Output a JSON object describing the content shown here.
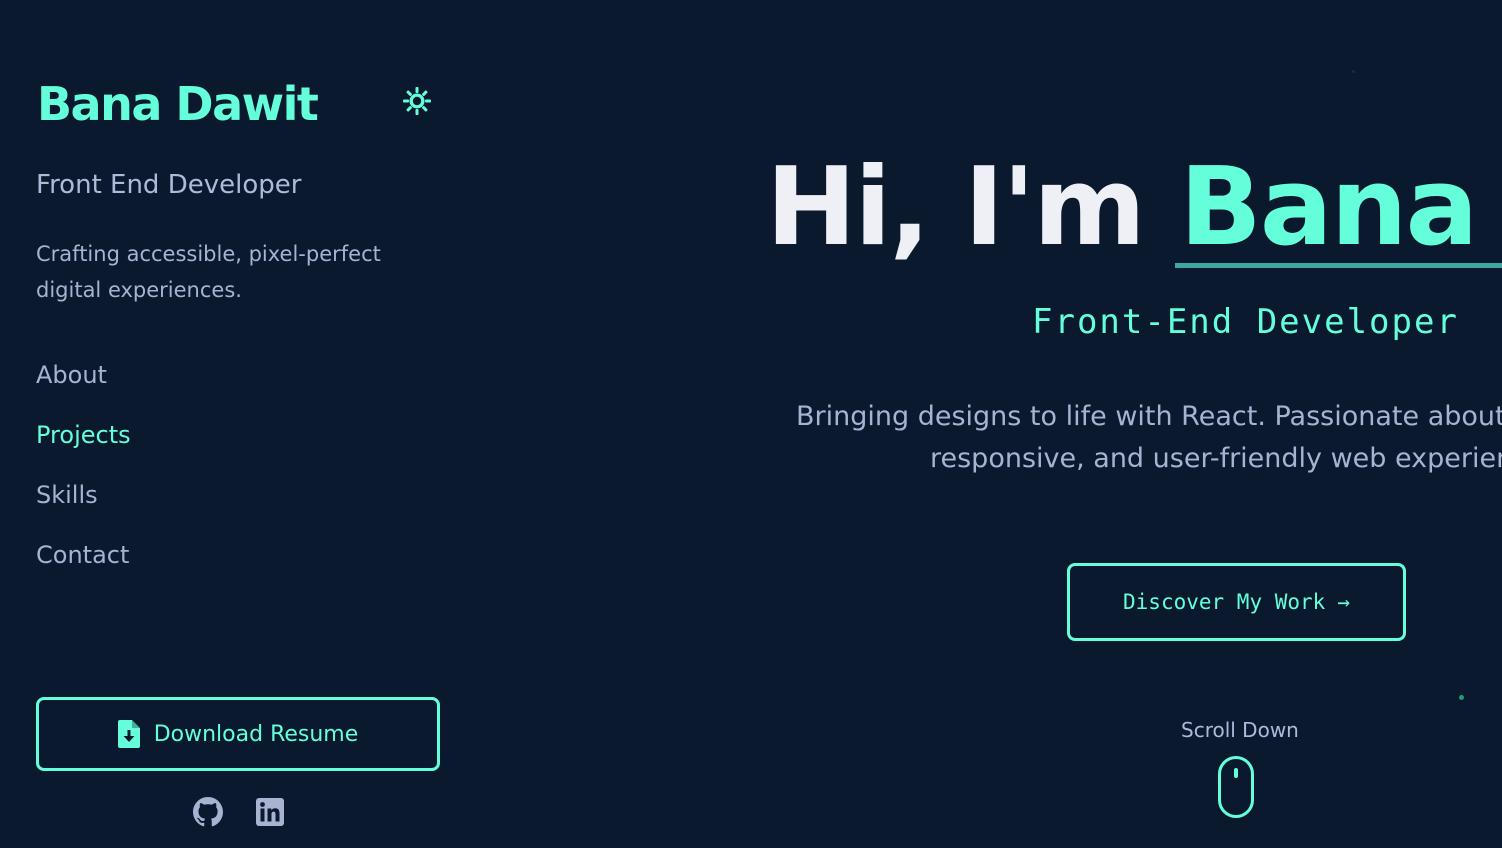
{
  "colors": {
    "background": "#0b192f",
    "accent": "#64ffda",
    "text_primary": "#eef0f6",
    "text_secondary": "#a8b2d1"
  },
  "sidebar": {
    "brand": {
      "first": "Bana",
      "last": "Dawit"
    },
    "theme_toggle_icon": "sun-icon",
    "role": "Front End Developer",
    "tagline_line1": "Crafting accessible, pixel-perfect",
    "tagline_line2": "digital experiences.",
    "nav": [
      {
        "label": "About",
        "active": false
      },
      {
        "label": "Projects",
        "active": true
      },
      {
        "label": "Skills",
        "active": false
      },
      {
        "label": "Contact",
        "active": false
      }
    ],
    "resume_button": {
      "label": "Download Resume",
      "icon": "file-download-icon"
    },
    "socials": [
      {
        "icon": "github-icon"
      },
      {
        "icon": "linkedin-icon"
      }
    ]
  },
  "hero": {
    "greeting": "Hi, I'm",
    "name": "Bana Da",
    "role": "Front-End Developer",
    "description_line1": "Bringing designs to life with React. Passionate about c",
    "description_line2": "responsive, and user-friendly web experienc",
    "cta_label": "Discover My Work",
    "cta_arrow": "→",
    "scroll_label": "Scroll Down"
  }
}
